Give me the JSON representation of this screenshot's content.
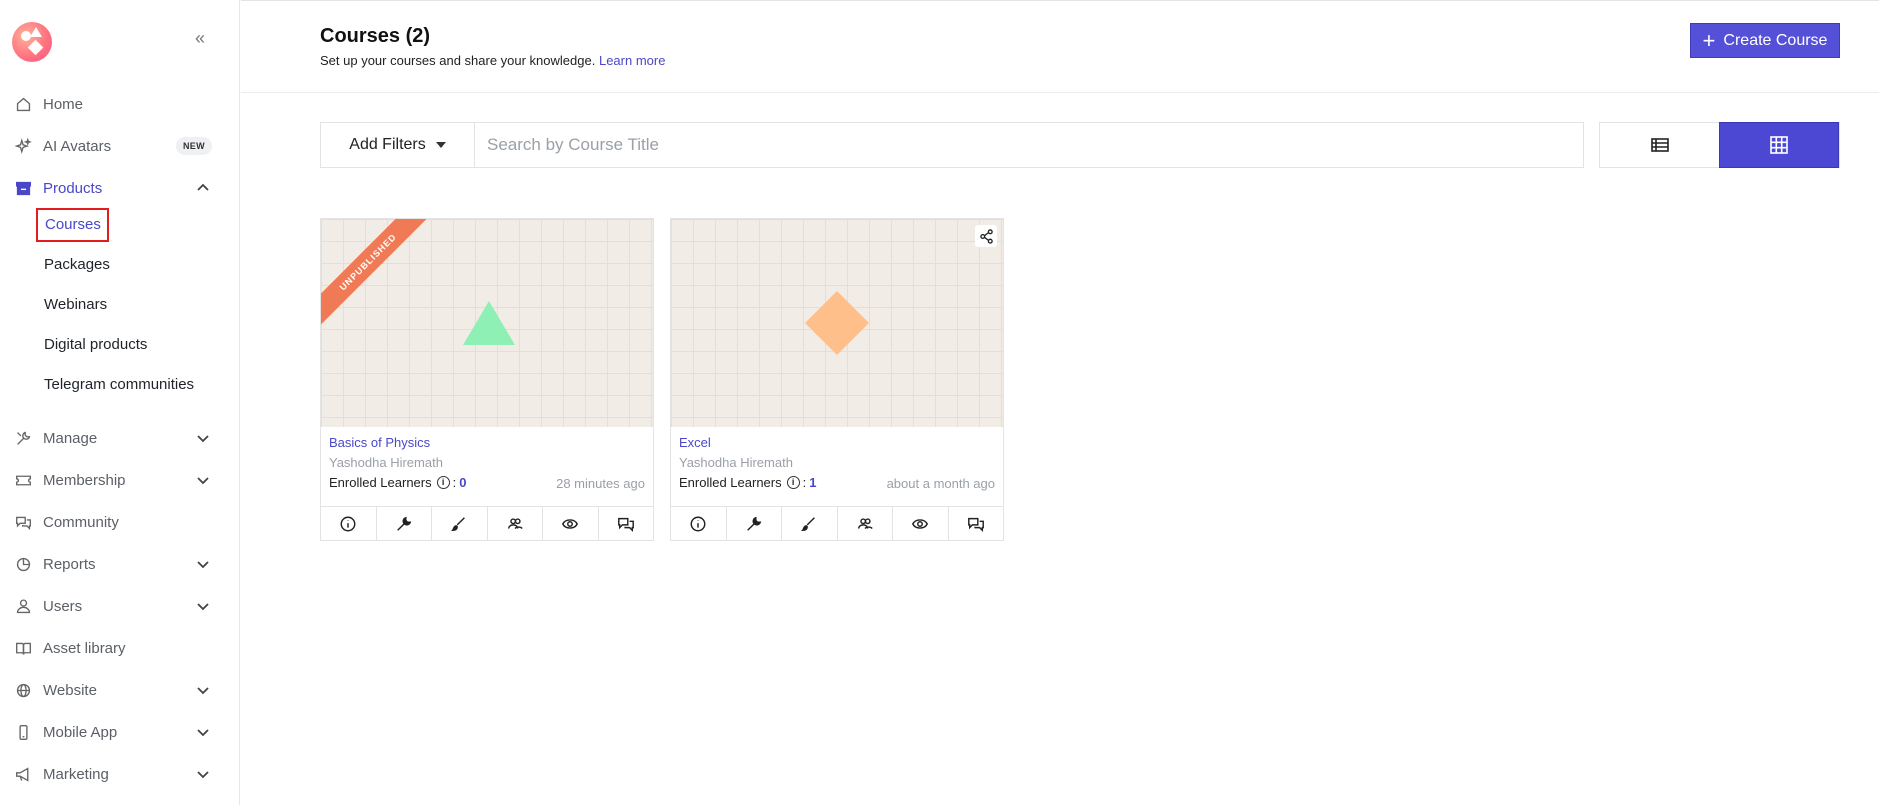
{
  "sidebar": {
    "nav": [
      {
        "label": "Home",
        "icon": "home-icon"
      },
      {
        "label": "AI Avatars",
        "icon": "sparkle-icon",
        "badge": "NEW"
      },
      {
        "label": "Products",
        "icon": "archive-icon",
        "expanded": true
      },
      {
        "label": "Manage",
        "icon": "tools-icon"
      },
      {
        "label": "Membership",
        "icon": "ticket-icon"
      },
      {
        "label": "Community",
        "icon": "chat-icon"
      },
      {
        "label": "Reports",
        "icon": "pie-chart-icon"
      },
      {
        "label": "Users",
        "icon": "user-icon"
      },
      {
        "label": "Asset library",
        "icon": "book-icon"
      },
      {
        "label": "Website",
        "icon": "globe-icon"
      },
      {
        "label": "Mobile App",
        "icon": "mobile-icon"
      },
      {
        "label": "Marketing",
        "icon": "megaphone-icon"
      }
    ],
    "products_sub": [
      "Courses",
      "Packages",
      "Webinars",
      "Digital products",
      "Telegram communities"
    ]
  },
  "header": {
    "title": "Courses (2)",
    "subtitle": "Set up your courses and share your knowledge.",
    "learn_more": "Learn more",
    "create_label": "Create Course"
  },
  "filters": {
    "add_filters_label": "Add Filters",
    "search_placeholder": "Search by Course Title"
  },
  "courses": [
    {
      "title": "Basics of Physics",
      "author": "Yashodha Hiremath",
      "enrolled_label": "Enrolled Learners",
      "enrolled": "0",
      "time": "28 minutes ago",
      "status": "UNPUBLISHED"
    },
    {
      "title": "Excel",
      "author": "Yashodha Hiremath",
      "enrolled_label": "Enrolled Learners",
      "enrolled": "1",
      "time": "about a month ago"
    }
  ],
  "colors": {
    "accent": "#4a47c9",
    "primary_button": "#5450d8",
    "ribbon": "#f07a56",
    "triangle": "#8ef0b4",
    "diamond": "#ffbf8a"
  }
}
